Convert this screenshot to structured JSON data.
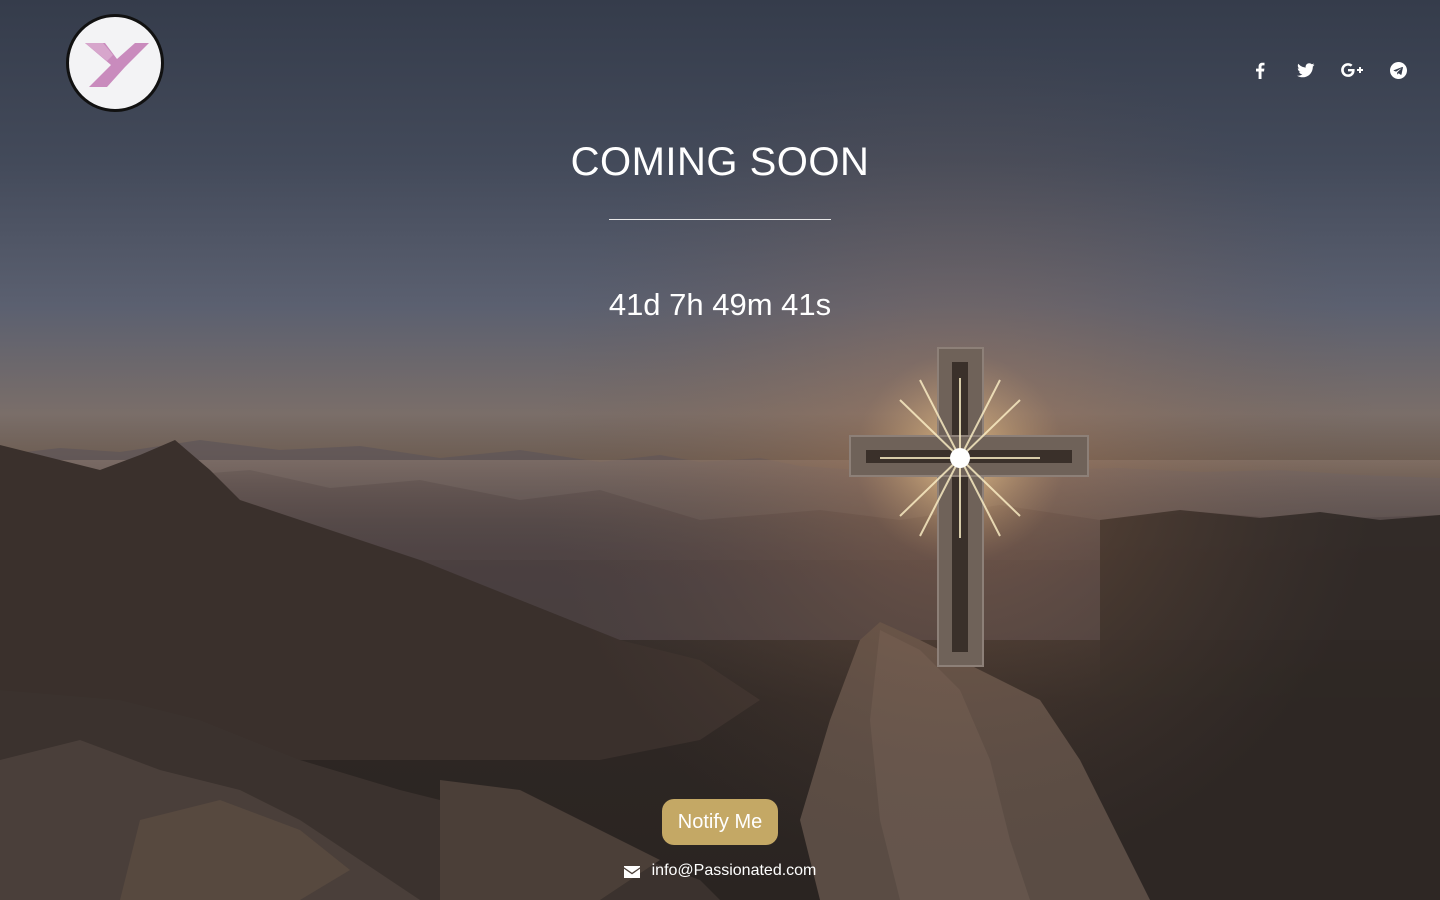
{
  "brand": {
    "logo_icon": "y-monogram-logo",
    "logo_color": "#c98bbd"
  },
  "social": [
    {
      "name": "facebook",
      "icon": "facebook-icon"
    },
    {
      "name": "twitter",
      "icon": "twitter-icon"
    },
    {
      "name": "google-plus",
      "icon": "google-plus-icon"
    },
    {
      "name": "telegram",
      "icon": "telegram-icon"
    }
  ],
  "hero": {
    "title": "COMING SOON",
    "countdown": "41d 7h 49m 41s"
  },
  "actions": {
    "notify_label": "Notify Me",
    "notify_color": "#c4a865"
  },
  "contact": {
    "icon": "envelope-icon",
    "email": "info@Passionated.com"
  }
}
